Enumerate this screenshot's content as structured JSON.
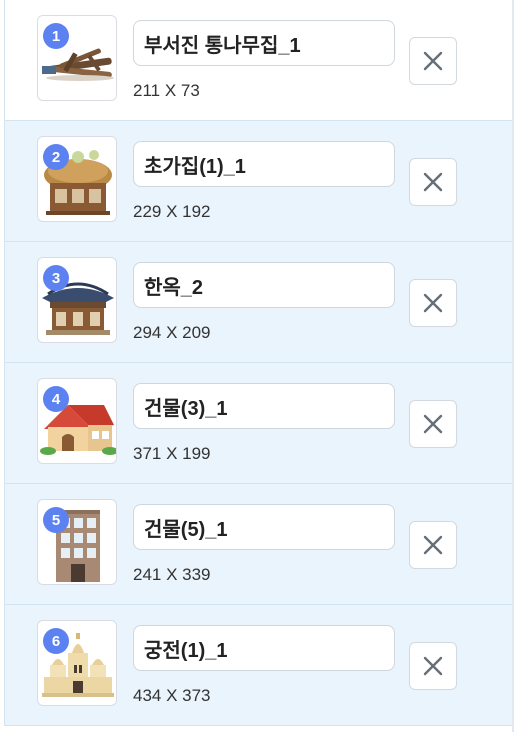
{
  "items": [
    {
      "number": "1",
      "name": "부서진 통나무집_1",
      "dims": "211 X 73",
      "icon": "broken-log-cabin-icon"
    },
    {
      "number": "2",
      "name": "초가집(1)_1",
      "dims": "229 X 192",
      "icon": "thatched-house-icon"
    },
    {
      "number": "3",
      "name": "한옥_2",
      "dims": "294 X 209",
      "icon": "hanok-icon"
    },
    {
      "number": "4",
      "name": "건물(3)_1",
      "dims": "371 X 199",
      "icon": "red-roof-house-icon"
    },
    {
      "number": "5",
      "name": "건물(5)_1",
      "dims": "241 X 339",
      "icon": "apartment-building-icon"
    },
    {
      "number": "6",
      "name": "궁전(1)_1",
      "dims": "434 X 373",
      "icon": "palace-icon"
    }
  ],
  "colors": {
    "badge": "#5b82f0",
    "row_alt_bg": "#eaf4fd",
    "close_x": "#666e78"
  }
}
